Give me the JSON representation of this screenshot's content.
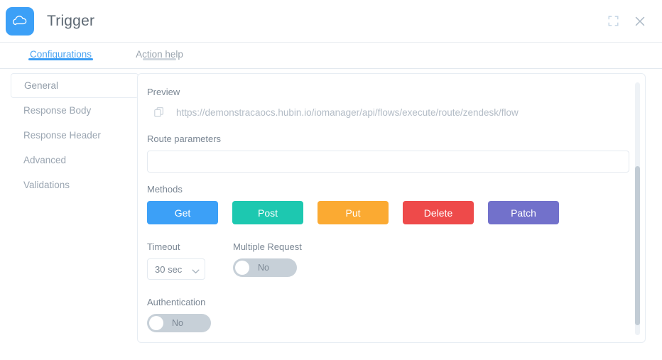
{
  "window": {
    "title": "Trigger",
    "logo_icon": "cloud-icon",
    "expand_icon": "fullscreen-icon",
    "close_icon": "close-icon",
    "brand_color": "#3CA0F7"
  },
  "tabs": [
    {
      "label": "Configurations",
      "active": true
    },
    {
      "label": "Action help",
      "active": false
    }
  ],
  "sidebar": {
    "items": [
      {
        "label": "General",
        "selected": true
      },
      {
        "label": "Response Body",
        "selected": false
      },
      {
        "label": "Response Header",
        "selected": false
      },
      {
        "label": "Advanced",
        "selected": false
      },
      {
        "label": "Validations",
        "selected": false
      }
    ]
  },
  "main": {
    "preview": {
      "label": "Preview",
      "copy_icon": "copy-icon",
      "url": "https://demonstracaocs.hubin.io/iomanager/api/flows/execute/route/zendesk/flow"
    },
    "route_parameters": {
      "label": "Route parameters",
      "value": "",
      "placeholder": ""
    },
    "methods": {
      "label": "Methods",
      "buttons": [
        {
          "label": "Get",
          "color": "#3CA0F7"
        },
        {
          "label": "Post",
          "color": "#1DC8B0"
        },
        {
          "label": "Put",
          "color": "#FBAA32"
        },
        {
          "label": "Delete",
          "color": "#EE4A4A"
        },
        {
          "label": "Patch",
          "color": "#7271CB"
        }
      ]
    },
    "timeout": {
      "label": "Timeout",
      "value": "30 sec",
      "chevron_icon": "chevron-down-icon"
    },
    "multiple_request": {
      "label": "Multiple Request",
      "state_label": "No",
      "on": false
    },
    "authentication": {
      "label": "Authentication",
      "state_label": "No",
      "on": false
    }
  }
}
